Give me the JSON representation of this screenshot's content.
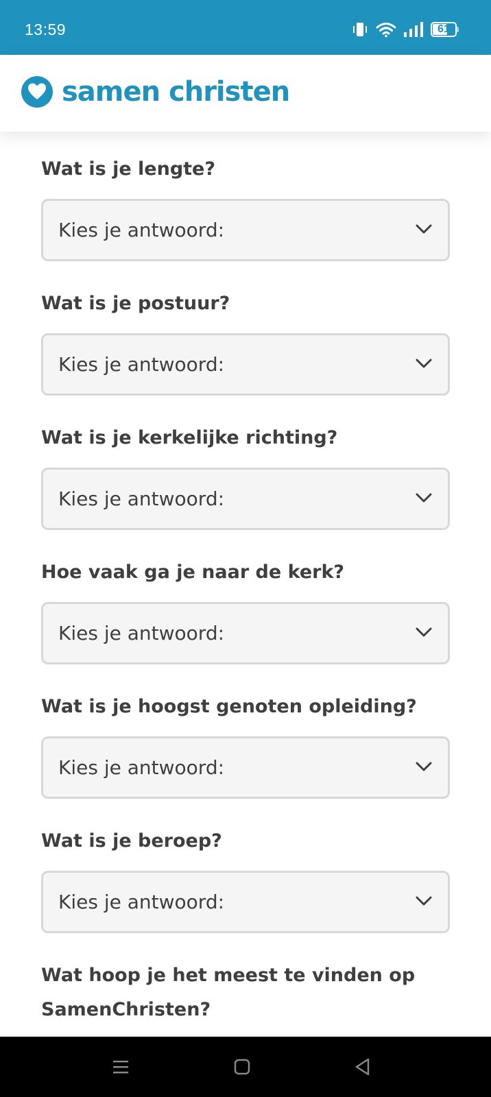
{
  "status_bar": {
    "time": "13:59",
    "battery_level": "61",
    "icons": [
      "vibrate-icon",
      "wifi-icon",
      "signal-icon",
      "battery-icon"
    ]
  },
  "header": {
    "logo_text": "samen christen",
    "brand_color": "#1f93bd"
  },
  "questions": [
    {
      "label": "Wat is je lengte?",
      "value": "Kies je antwoord:"
    },
    {
      "label": "Wat is je postuur?",
      "value": "Kies je antwoord:"
    },
    {
      "label": "Wat is je kerkelijke richting?",
      "value": "Kies je antwoord:"
    },
    {
      "label": "Hoe vaak ga je naar de kerk?",
      "value": "Kies je antwoord:"
    },
    {
      "label": "Wat is je hoogst genoten opleiding?",
      "value": "Kies je antwoord:"
    },
    {
      "label": "Wat is je beroep?",
      "value": "Kies je antwoord:"
    },
    {
      "label": "Wat hoop je het meest te vinden op SamenChristen?"
    }
  ],
  "nav_bar": {
    "icons": [
      "menu-icon",
      "home-icon",
      "back-icon"
    ]
  }
}
